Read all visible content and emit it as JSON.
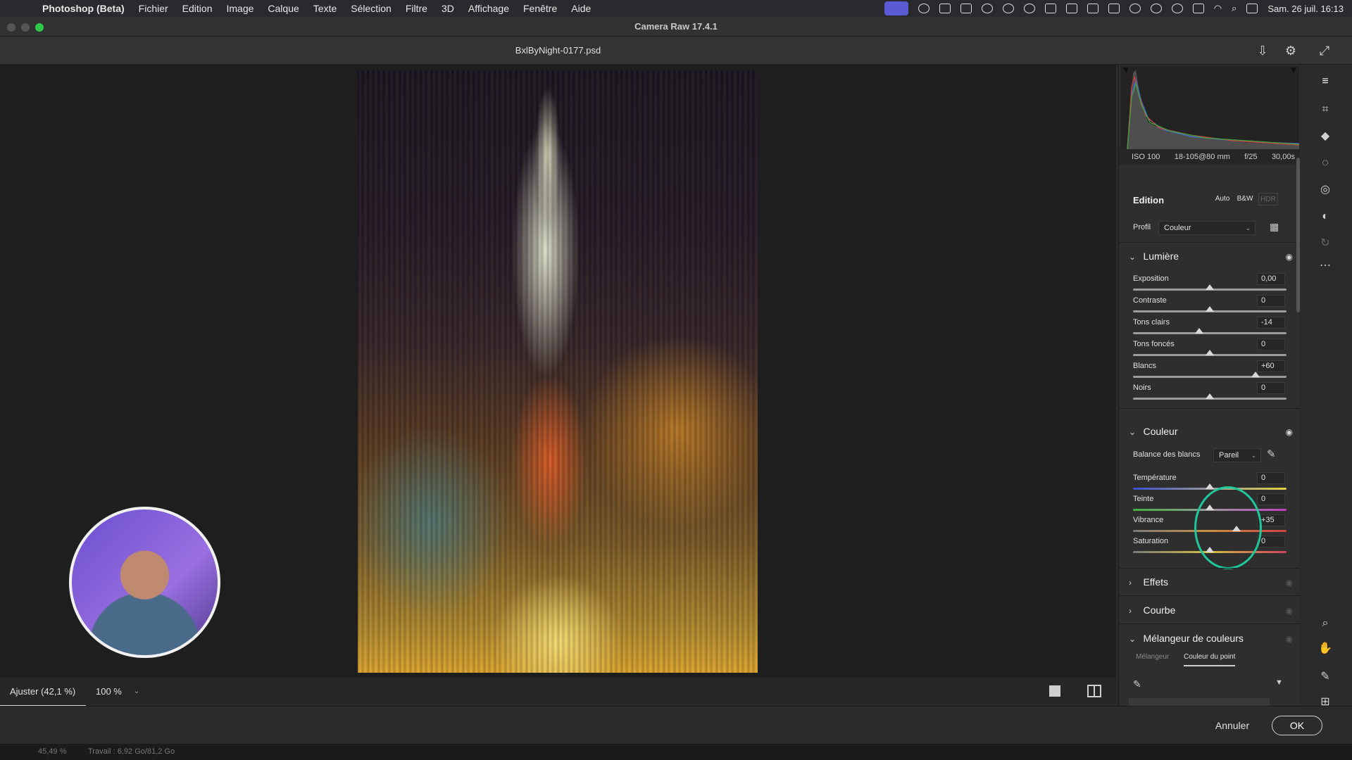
{
  "menubar": {
    "app": "Photoshop (Beta)",
    "items": [
      "Fichier",
      "Edition",
      "Image",
      "Calque",
      "Texte",
      "Sélection",
      "Filtre",
      "3D",
      "Affichage",
      "Fenêtre",
      "Aide"
    ],
    "clock": "Sam. 26 juil.  16:13"
  },
  "window": {
    "title": "Camera Raw 17.4.1",
    "filename": "BxlByNight-0177.psd"
  },
  "histogram": {
    "iso": "ISO 100",
    "lens": "18-105@80 mm",
    "aperture": "f/25",
    "shutter": "30,00s"
  },
  "edition": {
    "title": "Edition",
    "buttons": [
      "Auto",
      "B&W",
      "HDR"
    ],
    "profile_label": "Profil",
    "profile_value": "Couleur"
  },
  "lumiere": {
    "title": "Lumière",
    "sliders": [
      {
        "label": "Exposition",
        "value": "0,00",
        "pos": 0.5
      },
      {
        "label": "Contraste",
        "value": "0",
        "pos": 0.5
      },
      {
        "label": "Tons clairs",
        "value": "-14",
        "pos": 0.43
      },
      {
        "label": "Tons foncés",
        "value": "0",
        "pos": 0.5
      },
      {
        "label": "Blancs",
        "value": "+60",
        "pos": 0.8
      },
      {
        "label": "Noirs",
        "value": "0",
        "pos": 0.5
      }
    ]
  },
  "couleur": {
    "title": "Couleur",
    "wb_label": "Balance des blancs",
    "wb_value": "Pareil",
    "sliders": [
      {
        "label": "Température",
        "value": "0",
        "pos": 0.5
      },
      {
        "label": "Teinte",
        "value": "0",
        "pos": 0.5
      },
      {
        "label": "Vibrance",
        "value": "+35",
        "pos": 0.675
      },
      {
        "label": "Saturation",
        "value": "0",
        "pos": 0.5
      }
    ]
  },
  "sections": {
    "effets": "Effets",
    "courbe": "Courbe",
    "melangeur": "Mélangeur de couleurs",
    "tab_melangeur": "Mélangeur",
    "tab_point": "Couleur du point"
  },
  "canvas": {
    "zoom_fit": "Ajuster (42,1 %)",
    "zoom_100": "100 %"
  },
  "footer": {
    "cancel": "Annuler",
    "ok": "OK",
    "status_zoom": "45,49 %",
    "status_work": "Travail : 6,92 Go/81,2 Go"
  },
  "icons": {
    "save": "download-icon",
    "settings": "gear-icon",
    "fullscreen": "expand-icon"
  },
  "colors": {
    "accent_ring": "#1fc79a",
    "panel_bg": "#2e2e2e"
  }
}
